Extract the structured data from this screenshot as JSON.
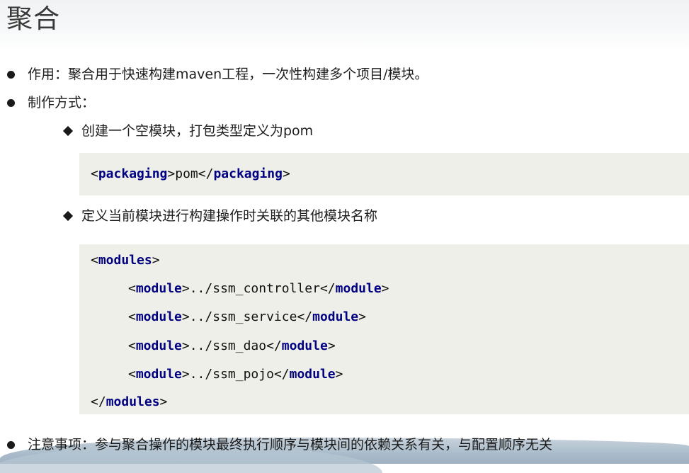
{
  "title": "聚合",
  "bullets": {
    "purpose": "作用：聚合用于快速构建maven工程，一次性构建多个项目/模块。",
    "method": "制作方式：",
    "note": "注意事项：参与聚合操作的模块最终执行顺序与模块间的依赖关系有关，与配置顺序无关"
  },
  "sub_items": {
    "step1": "创建一个空模块，打包类型定义为pom",
    "step2": "定义当前模块进行构建操作时关联的其他模块名称"
  },
  "code1": {
    "open": "<",
    "tag": "packaging",
    "gt": ">",
    "value": "pom",
    "close_open": "</",
    "close_tag": "packaging",
    "close_gt": ">"
  },
  "code2": {
    "modules_open_lt": "<",
    "modules_tag": "modules",
    "modules_open_gt": ">",
    "module_tag": "module",
    "modules": [
      "../ssm_controller",
      "../ssm_service",
      "../ssm_dao",
      "../ssm_pojo"
    ],
    "modules_close_lt": "</",
    "modules_close_gt": ">"
  }
}
